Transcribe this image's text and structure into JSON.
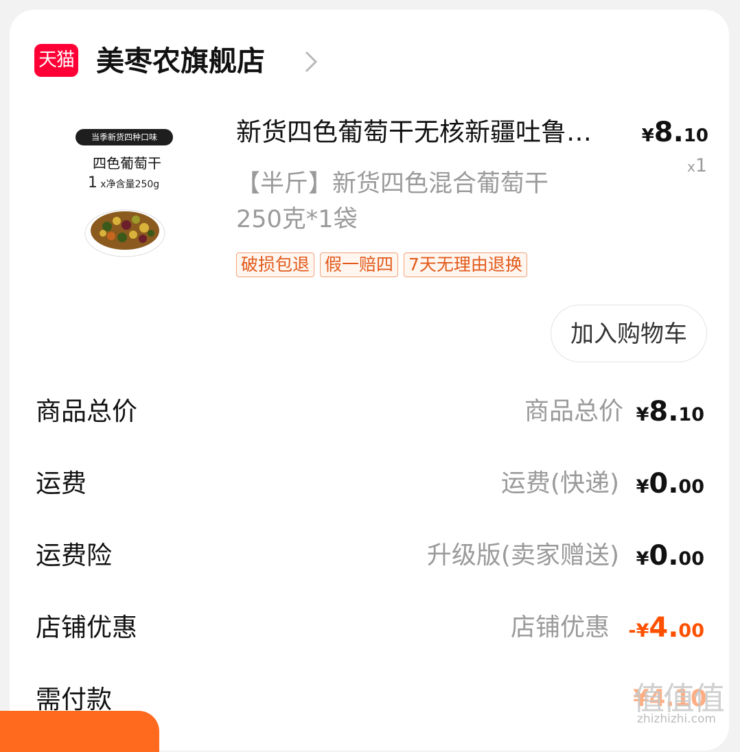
{
  "shop": {
    "logo_text": "天猫",
    "name": "美枣农旗舰店"
  },
  "product": {
    "image": {
      "badge": "当季新货四种口味",
      "title": "四色葡萄干",
      "weight_prefix": "1",
      "weight_text": "x净含量250g"
    },
    "title": "新货四色葡萄干无核新疆吐鲁…",
    "sku_line1": "【半斤】新货四色混合葡萄干",
    "sku_line2": "250克*1袋",
    "price_symbol": "¥",
    "price_int": "8.",
    "price_dec": "10",
    "qty_x": "x",
    "qty": "1",
    "tags": [
      "破损包退",
      "假一赔四",
      "7天无理由退换"
    ],
    "add_to_cart": "加入购物车"
  },
  "summary": [
    {
      "label": "商品总价",
      "sub": "商品总价",
      "sym": "¥",
      "int": "8.",
      "dec": "10",
      "negative": false
    },
    {
      "label": "运费",
      "sub": "运费(快递)",
      "sym": "¥",
      "int": "0.",
      "dec": "00",
      "negative": false
    },
    {
      "label": "运费险",
      "sub": "升级版(卖家赠送)",
      "sym": "¥",
      "int": "0.",
      "dec": "00",
      "negative": false
    },
    {
      "label": "店铺优惠",
      "sub": "店铺优惠",
      "sym": "-¥",
      "int": "4.",
      "dec": "00",
      "negative": true
    },
    {
      "label": "需付款",
      "sub": "",
      "sym": "¥",
      "int": "4.",
      "dec": "10",
      "negative": false
    }
  ],
  "watermark": {
    "text": "值值值",
    "url": "zhizhizhi.com"
  },
  "colors": {
    "accent": "#ff5000",
    "tmall": "#ff0036",
    "tag_border": "#f0a27a"
  }
}
